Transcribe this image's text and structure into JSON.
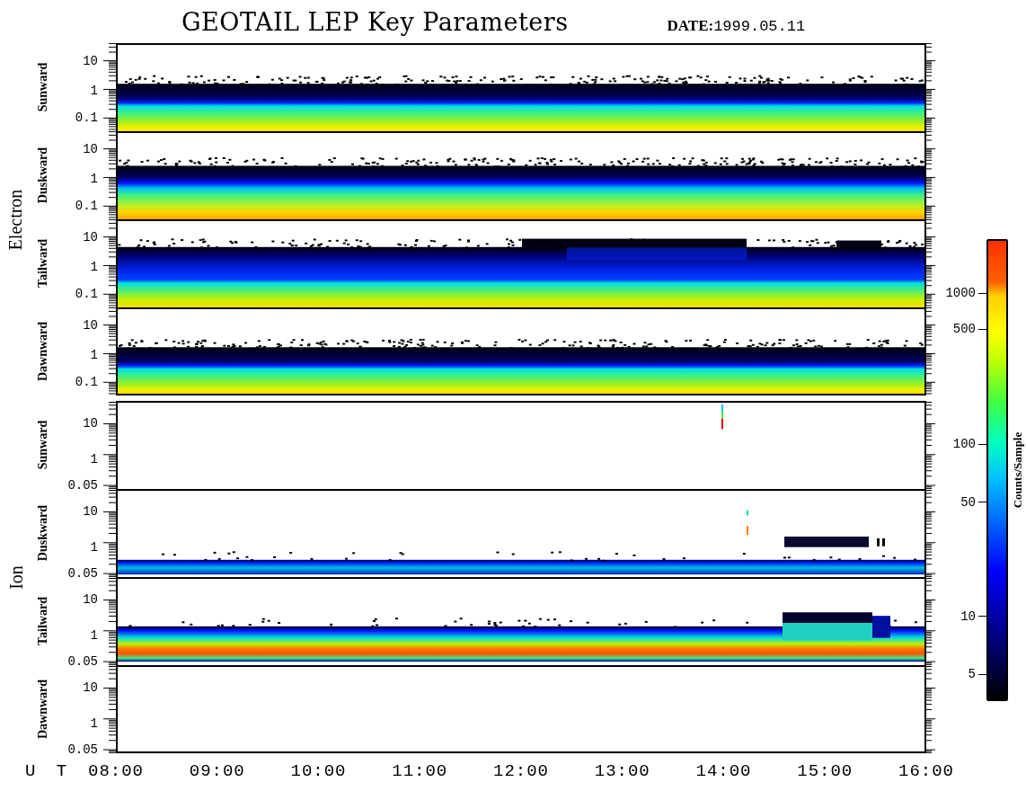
{
  "title": "GEOTAIL LEP Key Parameters",
  "date": "**DATE:**1999.05.11",
  "species": [
    {
      "label": "Electron",
      "panels": [
        {
          "direction": "Sunward",
          "y_ticks": [
            "10",
            "1",
            "0.1"
          ]
        },
        {
          "direction": "Duskward",
          "y_ticks": [
            "10",
            "1",
            "0.1"
          ]
        },
        {
          "direction": "Tailward",
          "y_ticks": [
            "10",
            "1",
            "0.1"
          ]
        },
        {
          "direction": "Dawnward",
          "y_ticks": [
            "10",
            "1",
            "0.1"
          ]
        }
      ]
    },
    {
      "label": "Ion",
      "panels": [
        {
          "direction": "Sunward",
          "y_ticks": [
            "10",
            "1",
            "0.05"
          ]
        },
        {
          "direction": "Duskward",
          "y_ticks": [
            "10",
            "1",
            "0.05"
          ]
        },
        {
          "direction": "Tailward",
          "y_ticks": [
            "10",
            "1",
            "0.05"
          ]
        },
        {
          "direction": "Dawnward",
          "y_ticks": [
            "10",
            "1",
            "0.05"
          ]
        }
      ]
    }
  ],
  "x_axis": {
    "label": "U T",
    "ticks": [
      "08:00",
      "09:00",
      "10:00",
      "11:00",
      "12:00",
      "13:00",
      "14:00",
      "15:00",
      "16:00"
    ]
  },
  "colorbar": {
    "label": "Counts/Sample",
    "ticks": [
      "1000",
      "500",
      "100",
      "50",
      "10",
      "5"
    ]
  }
}
